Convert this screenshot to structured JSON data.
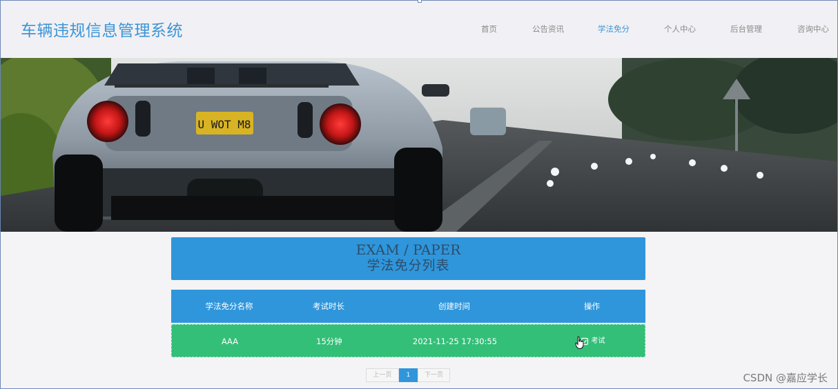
{
  "header": {
    "site_title": "车辆违规信息管理系统",
    "nav": [
      {
        "label": "首页",
        "active": false
      },
      {
        "label": "公告资讯",
        "active": false
      },
      {
        "label": "学法免分",
        "active": true
      },
      {
        "label": "个人中心",
        "active": false
      },
      {
        "label": "后台管理",
        "active": false
      },
      {
        "label": "咨询中心",
        "active": false
      }
    ]
  },
  "banner": {
    "license_plate": "U WOT M8"
  },
  "section": {
    "title_en": "EXAM / PAPER",
    "title_cn": "学法免分列表"
  },
  "table": {
    "headers": [
      "学法免分名称",
      "考试时长",
      "创建时间",
      "操作"
    ],
    "rows": [
      {
        "name": "AAA",
        "duration": "15分钟",
        "created": "2021-11-25 17:30:55",
        "action_label": "考试",
        "action_icon": "exam-icon"
      }
    ]
  },
  "pagination": {
    "prev": "上一页",
    "current": "1",
    "next": "下一页"
  },
  "watermark": "CSDN @嘉应学长",
  "colors": {
    "accent": "#2f96dc",
    "row": "#33bf78",
    "title": "#3b95d6"
  }
}
